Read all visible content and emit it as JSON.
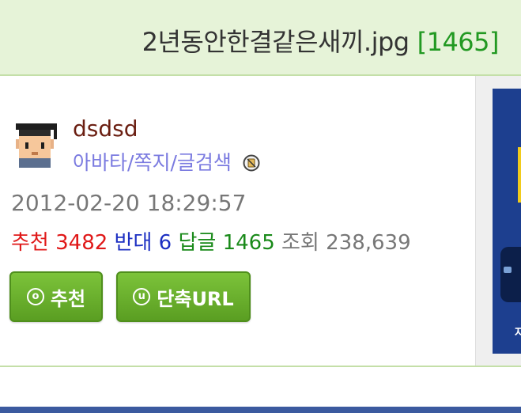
{
  "header": {
    "title": "2년동안한결같은새끼.jpg",
    "comment_count": "[1465]"
  },
  "author": {
    "nickname": "dsdsd",
    "links": [
      "아바타",
      "쪽지",
      "글검색"
    ],
    "separator": "/",
    "datetime": "2012-02-20 18:29:57"
  },
  "stats": {
    "recommend_label": "추천",
    "recommend_value": "3482",
    "oppose_label": "반대",
    "oppose_value": "6",
    "reply_label": "답글",
    "reply_value": "1465",
    "views_label": "조회",
    "views_value": "238,639"
  },
  "buttons": {
    "recommend_icon": "o",
    "recommend_label": "추천",
    "shorturl_icon": "u",
    "shorturl_label": "단축URL"
  },
  "ad": {
    "text": "자"
  },
  "colors": {
    "title_bg": "#e6f3d8",
    "nick": "#6b1f12",
    "link": "#7b7be0",
    "recommend": "#e01818",
    "oppose": "#1c2fc2",
    "reply": "#1a8a1a",
    "button": "#6ab22c"
  },
  "icons": {
    "avatar": "graduation-cap-avatar",
    "badge": "crossed-circle-badge-icon"
  }
}
